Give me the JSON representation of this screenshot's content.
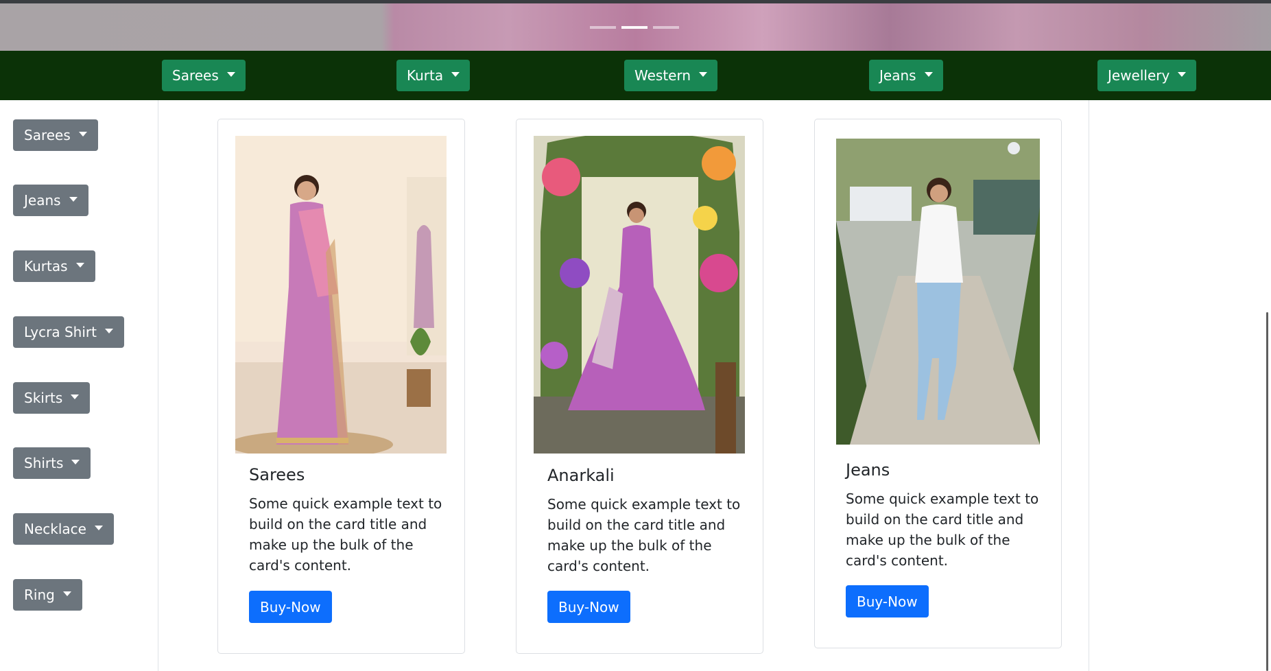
{
  "carousel": {
    "slides": 3,
    "active": 2
  },
  "topnav": {
    "items": [
      {
        "label": "Sarees"
      },
      {
        "label": "Kurta"
      },
      {
        "label": "Western"
      },
      {
        "label": "Jeans"
      },
      {
        "label": "Jewellery"
      }
    ]
  },
  "sidebar": {
    "items": [
      {
        "label": "Sarees"
      },
      {
        "label": "Jeans"
      },
      {
        "label": "Kurtas"
      },
      {
        "label": "Lycra Shirt"
      },
      {
        "label": "Skirts"
      },
      {
        "label": "Shirts"
      },
      {
        "label": "Necklace"
      },
      {
        "label": "Ring"
      }
    ]
  },
  "cards": [
    {
      "title": "Sarees",
      "text": "Some quick example text to build on the card title and make up the bulk of the card's content.",
      "button": "Buy-Now"
    },
    {
      "title": "Anarkali",
      "text": "Some quick example text to build on the card title and make up the bulk of the card's content.",
      "button": "Buy-Now"
    },
    {
      "title": "Jeans",
      "text": "Some quick example text to build on the card title and make up the bulk of the card's content.",
      "button": "Buy-Now"
    }
  ],
  "colors": {
    "topnav_bg": "#0b3207",
    "topnav_button": "#198754",
    "sidebar_button": "#6c757d",
    "buy_button": "#0d6efd"
  },
  "icons": {
    "dropdown": "caret-down-icon"
  }
}
